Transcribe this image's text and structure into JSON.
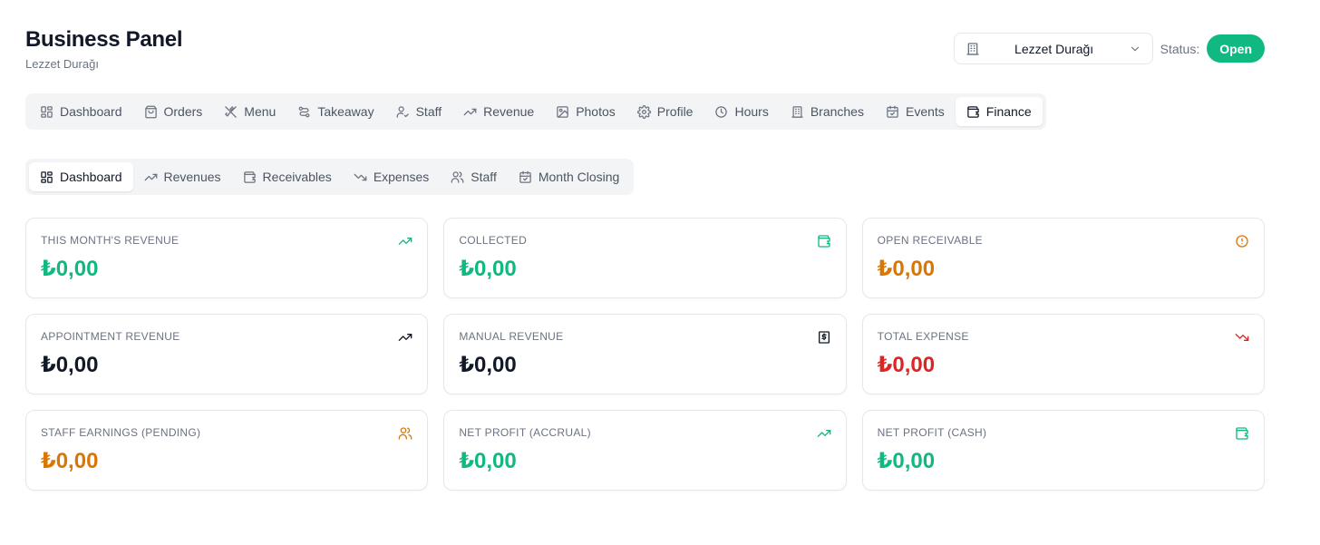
{
  "header": {
    "title": "Business Panel",
    "subtitle": "Lezzet Durağı"
  },
  "branch_select": {
    "value": "Lezzet Durağı"
  },
  "status": {
    "label": "Status:",
    "badge": "Open",
    "color": "#10b981"
  },
  "main_tabs": [
    {
      "label": "Dashboard",
      "icon": "dashboard-grid-icon"
    },
    {
      "label": "Orders",
      "icon": "shopping-bag-icon"
    },
    {
      "label": "Menu",
      "icon": "utensils-icon"
    },
    {
      "label": "Takeaway",
      "icon": "route-icon"
    },
    {
      "label": "Staff",
      "icon": "user-check-icon"
    },
    {
      "label": "Revenue",
      "icon": "trending-up-icon"
    },
    {
      "label": "Photos",
      "icon": "image-icon"
    },
    {
      "label": "Profile",
      "icon": "gear-icon"
    },
    {
      "label": "Hours",
      "icon": "clock-icon"
    },
    {
      "label": "Branches",
      "icon": "building-icon"
    },
    {
      "label": "Events",
      "icon": "calendar-check-icon"
    },
    {
      "label": "Finance",
      "icon": "wallet-icon",
      "active": true
    }
  ],
  "sub_tabs": [
    {
      "label": "Dashboard",
      "icon": "dashboard-grid-icon",
      "active": true
    },
    {
      "label": "Revenues",
      "icon": "trending-up-icon"
    },
    {
      "label": "Receivables",
      "icon": "wallet-icon"
    },
    {
      "label": "Expenses",
      "icon": "trending-down-icon"
    },
    {
      "label": "Staff",
      "icon": "users-icon"
    },
    {
      "label": "Month Closing",
      "icon": "calendar-check-icon"
    }
  ],
  "cards": [
    {
      "label": "This Month's Revenue",
      "value": "₺0,00",
      "color": "#10b981",
      "icon": "trending-up-icon",
      "icon_color": "#10b981"
    },
    {
      "label": "Collected",
      "value": "₺0,00",
      "color": "#10b981",
      "icon": "wallet-icon",
      "icon_color": "#10b981"
    },
    {
      "label": "Open Receivable",
      "value": "₺0,00",
      "color": "#d97706",
      "icon": "alert-circle-icon",
      "icon_color": "#d97706"
    },
    {
      "label": "Appointment Revenue",
      "value": "₺0,00",
      "color": "#111827",
      "icon": "trending-up-icon",
      "icon_color": "#111827"
    },
    {
      "label": "Manual Revenue",
      "value": "₺0,00",
      "color": "#111827",
      "icon": "receipt-icon",
      "icon_color": "#111827"
    },
    {
      "label": "Total Expense",
      "value": "₺0,00",
      "color": "#dc2626",
      "icon": "trending-down-icon",
      "icon_color": "#dc2626"
    },
    {
      "label": "Staff Earnings (Pending)",
      "value": "₺0,00",
      "color": "#d97706",
      "icon": "users-icon",
      "icon_color": "#d97706"
    },
    {
      "label": "Net Profit (Accrual)",
      "value": "₺0,00",
      "color": "#10b981",
      "icon": "trending-up-icon",
      "icon_color": "#10b981"
    },
    {
      "label": "Net Profit (Cash)",
      "value": "₺0,00",
      "color": "#10b981",
      "icon": "wallet-icon",
      "icon_color": "#10b981"
    }
  ]
}
